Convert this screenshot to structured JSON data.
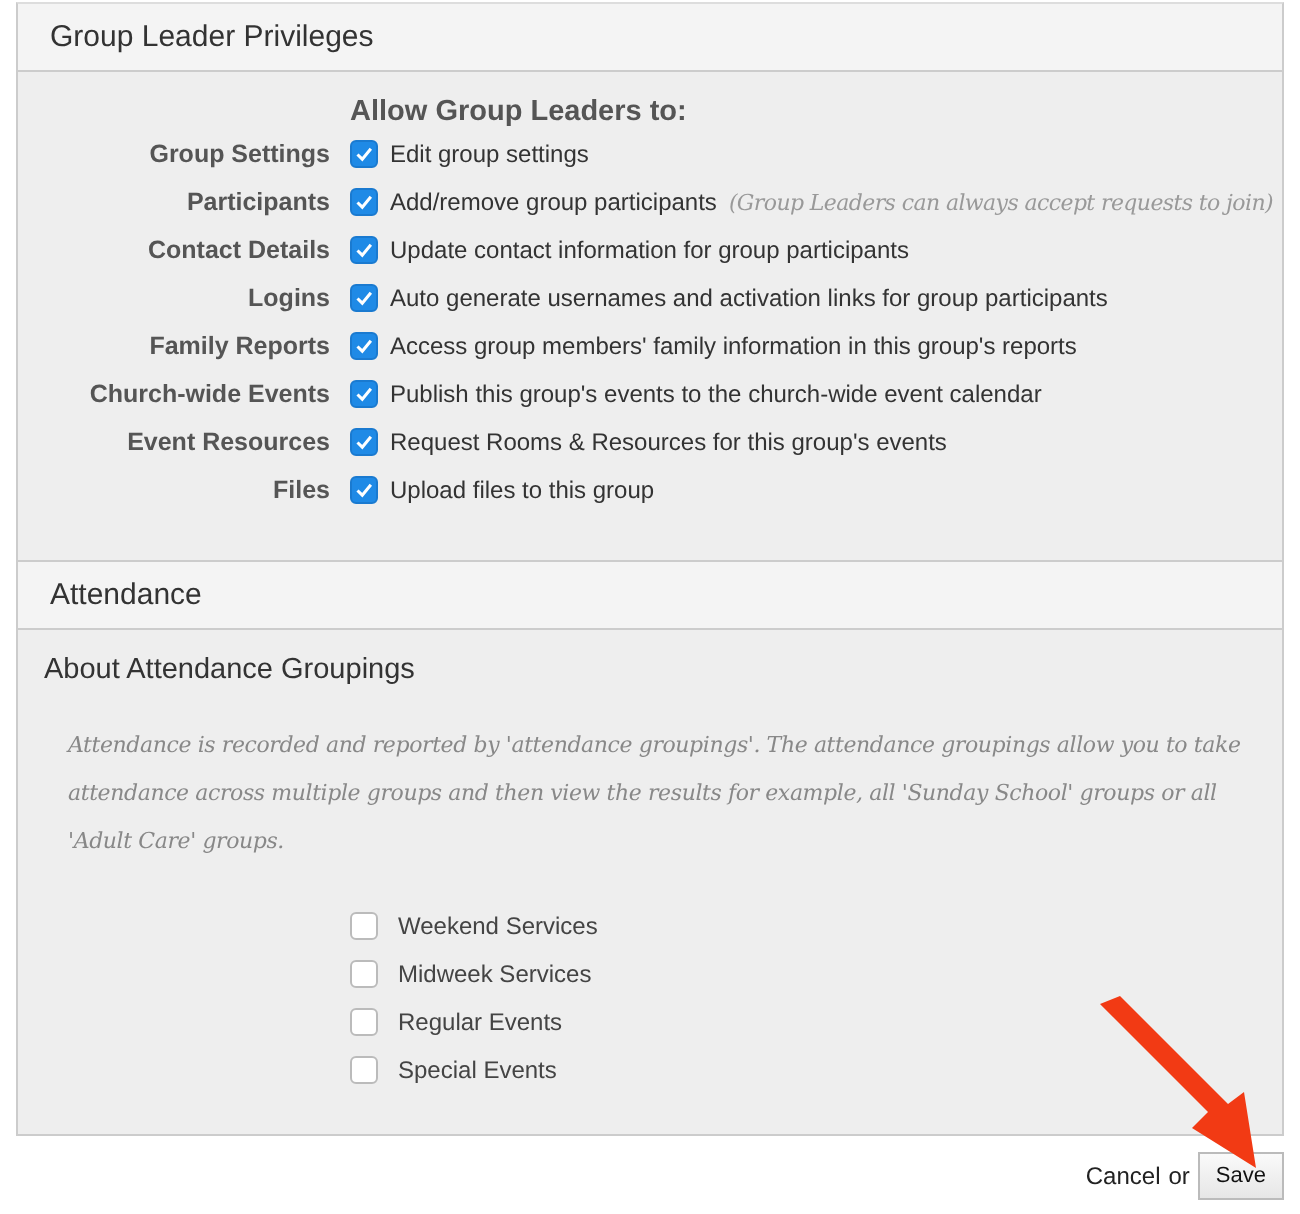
{
  "privileges": {
    "title": "Group Leader Privileges",
    "heading": "Allow Group Leaders to:",
    "rows": [
      {
        "label": "Group Settings",
        "text": "Edit group settings",
        "checked": true
      },
      {
        "label": "Participants",
        "text": "Add/remove group participants",
        "note": "(Group Leaders can always accept requests to join)",
        "checked": true
      },
      {
        "label": "Contact Details",
        "text": "Update contact information for group participants",
        "checked": true
      },
      {
        "label": "Logins",
        "text": "Auto generate usernames and activation links for group participants",
        "checked": true
      },
      {
        "label": "Family Reports",
        "text": "Access group members' family information in this group's reports",
        "checked": true
      },
      {
        "label": "Church-wide Events",
        "text": "Publish this group's events to the church-wide event calendar",
        "checked": true
      },
      {
        "label": "Event Resources",
        "text": "Request Rooms & Resources for this group's events",
        "checked": true
      },
      {
        "label": "Files",
        "text": "Upload files to this group",
        "checked": true
      }
    ]
  },
  "attendance": {
    "title": "Attendance",
    "subtitle": "About Attendance Groupings",
    "description": "Attendance is recorded and reported by 'attendance groupings'. The attendance groupings allow you to take attendance across multiple groups and then view the results for example, all 'Sunday School' groups or all 'Adult Care' groups.",
    "groupings": [
      {
        "label": "Weekend Services",
        "checked": false
      },
      {
        "label": "Midweek Services",
        "checked": false
      },
      {
        "label": "Regular Events",
        "checked": false
      },
      {
        "label": "Special Events",
        "checked": false
      }
    ]
  },
  "footer": {
    "cancel": "Cancel",
    "separator": "or",
    "save": "Save"
  }
}
